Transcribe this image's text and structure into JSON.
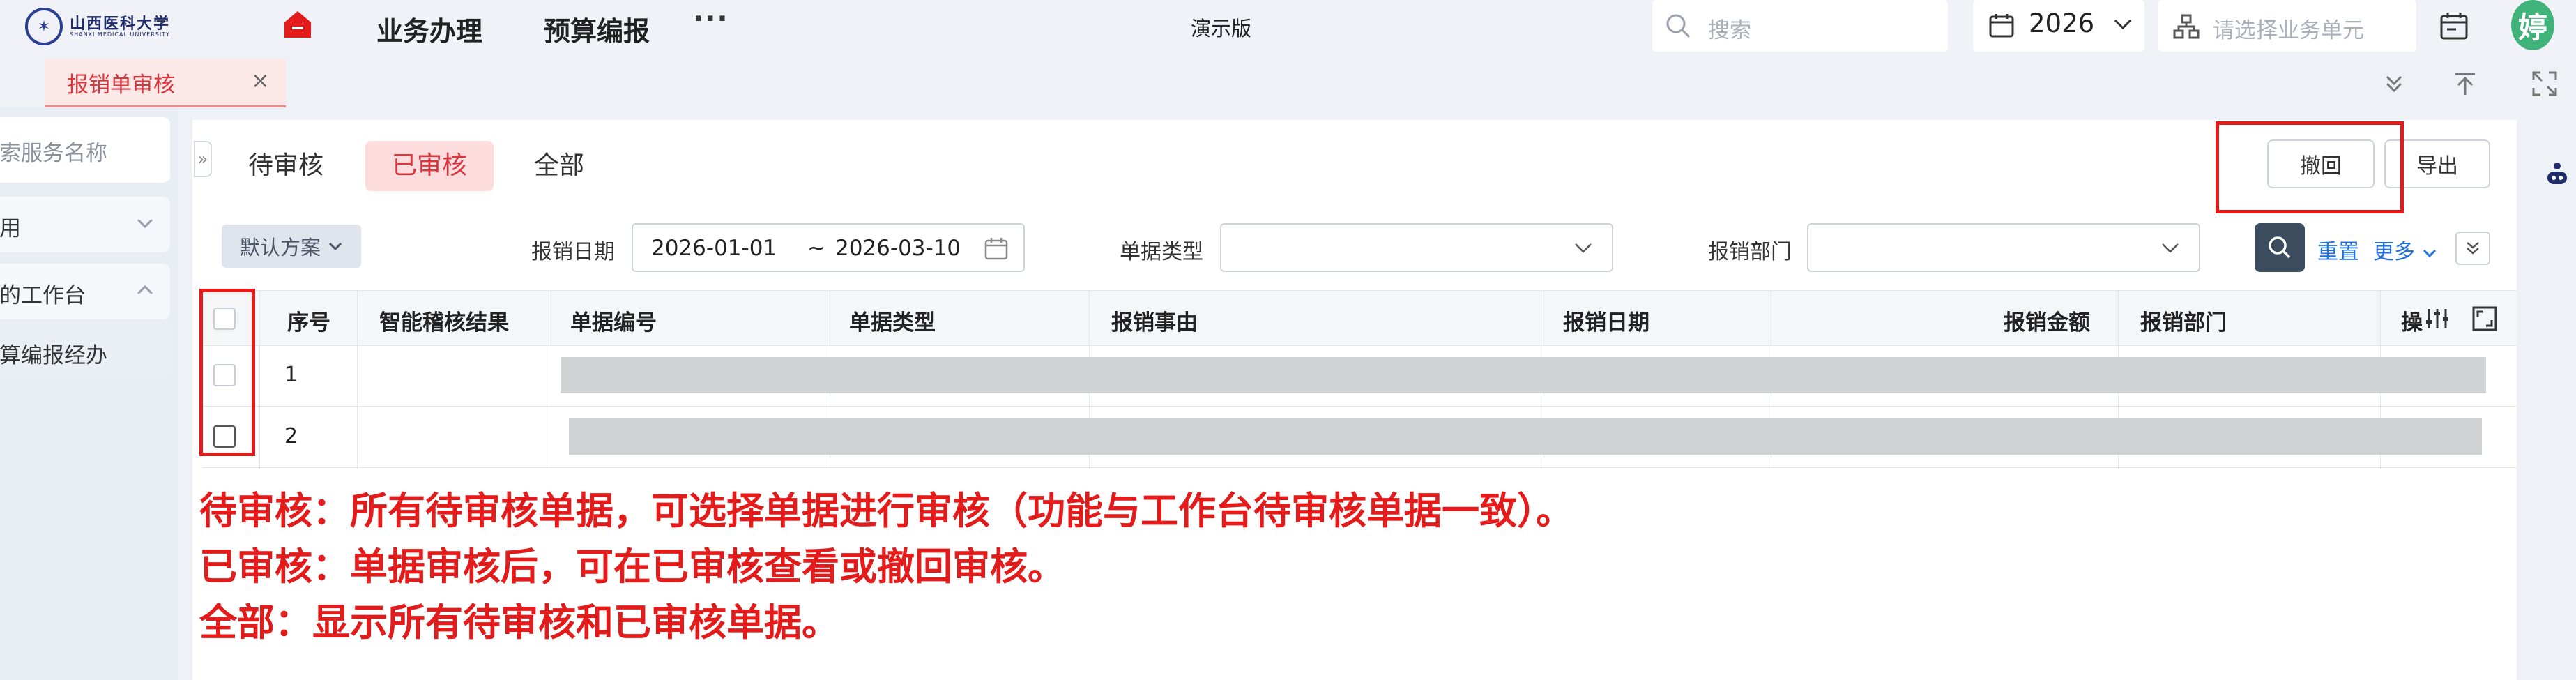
{
  "header": {
    "logo": {
      "cn": "山西医科大学",
      "en": "SHANXI MEDICAL UNIVERSITY"
    },
    "nav": [
      "业务办理",
      "预算编报"
    ],
    "more": "···",
    "edition": "演示版",
    "search_placeholder": "搜索",
    "year": "2026",
    "unit_placeholder": "请选择业务单元",
    "avatar": "婷"
  },
  "tabs": {
    "active": "报销单审核",
    "close": "×"
  },
  "sidebar": {
    "search_placeholder": "搜索服务名称",
    "items": [
      {
        "label": "常用",
        "expanded": false
      },
      {
        "label": "我的工作台",
        "expanded": true
      }
    ],
    "sub_items": [
      "预算编报经办"
    ]
  },
  "panel": {
    "status_tabs": [
      "待审核",
      "已审核",
      "全部"
    ],
    "active_status": "已审核",
    "buttons": {
      "withdraw": "撤回",
      "export": "导出"
    }
  },
  "filters": {
    "scheme": "默认方案",
    "date_label": "报销日期",
    "date_start": "2026-01-01",
    "date_sep": "~",
    "date_end": "2026-03-10",
    "type_label": "单据类型",
    "dept_label": "报销部门",
    "reset": "重置",
    "more": "更多"
  },
  "table": {
    "columns": [
      "序号",
      "智能稽核结果",
      "单据编号",
      "单据类型",
      "报销事由",
      "报销日期",
      "报销金额",
      "报销部门",
      "操"
    ],
    "rows": [
      {
        "index": "1"
      },
      {
        "index": "2"
      }
    ]
  },
  "annotations": [
    "待审核：所有待审核单据，可选择单据进行审核（功能与工作台待审核单据一致）。",
    "已审核：单据审核后，可在已审核查看或撤回审核。",
    "全部：显示所有待审核和已审核单据。"
  ],
  "colors": {
    "accent_red": "#d9363e",
    "annotation_red": "#e31b1b",
    "link_blue": "#1f6fe0",
    "avatar_green": "#40b37a"
  }
}
